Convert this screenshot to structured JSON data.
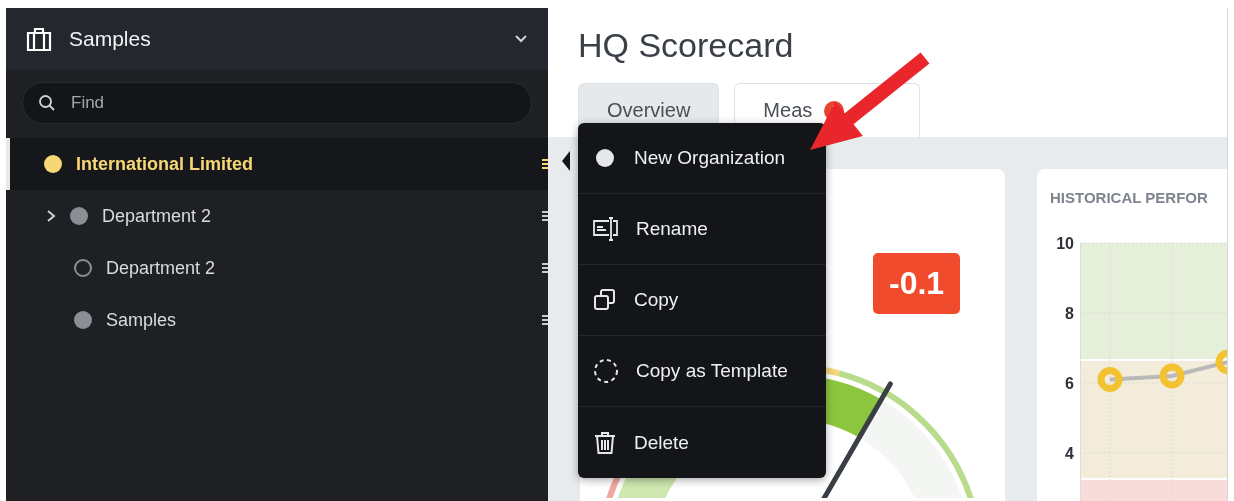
{
  "sidebar": {
    "title": "Samples",
    "search": {
      "placeholder": "Find"
    },
    "items": [
      {
        "label": "International Limited",
        "selected": true,
        "color": "#f7d774",
        "kind": "filled",
        "children": [
          {
            "label": "Department 2",
            "selected": false,
            "color": "#8a8f96",
            "kind": "filled",
            "expanded": false
          },
          {
            "label": "Department 2",
            "selected": false,
            "color": "#8a8f96",
            "kind": "outline"
          },
          {
            "label": "Samples",
            "selected": false,
            "color": "#8a8f96",
            "kind": "filled"
          }
        ]
      }
    ]
  },
  "page": {
    "title": "HQ Scorecard"
  },
  "tabs": [
    {
      "label": "Overview",
      "selected": false,
      "alert": false
    },
    {
      "label": "Meas",
      "selected": true,
      "alert": true
    }
  ],
  "score_badge": "-0.1",
  "chart": {
    "chart_data": {
      "type": "line",
      "title": "HISTORICAL PERFOR",
      "ylim": [
        2.6,
        10
      ],
      "yticks": [
        4,
        6,
        8,
        10
      ],
      "grid": true,
      "marker": "circle",
      "values": [
        6.1,
        6.2,
        6.6
      ]
    }
  },
  "context_menu": [
    {
      "kind": "dot",
      "label": "New Organization"
    },
    {
      "kind": "rename",
      "label": "Rename"
    },
    {
      "kind": "copy",
      "label": "Copy"
    },
    {
      "kind": "template",
      "label": "Copy as Template"
    },
    {
      "kind": "delete",
      "label": "Delete"
    }
  ]
}
